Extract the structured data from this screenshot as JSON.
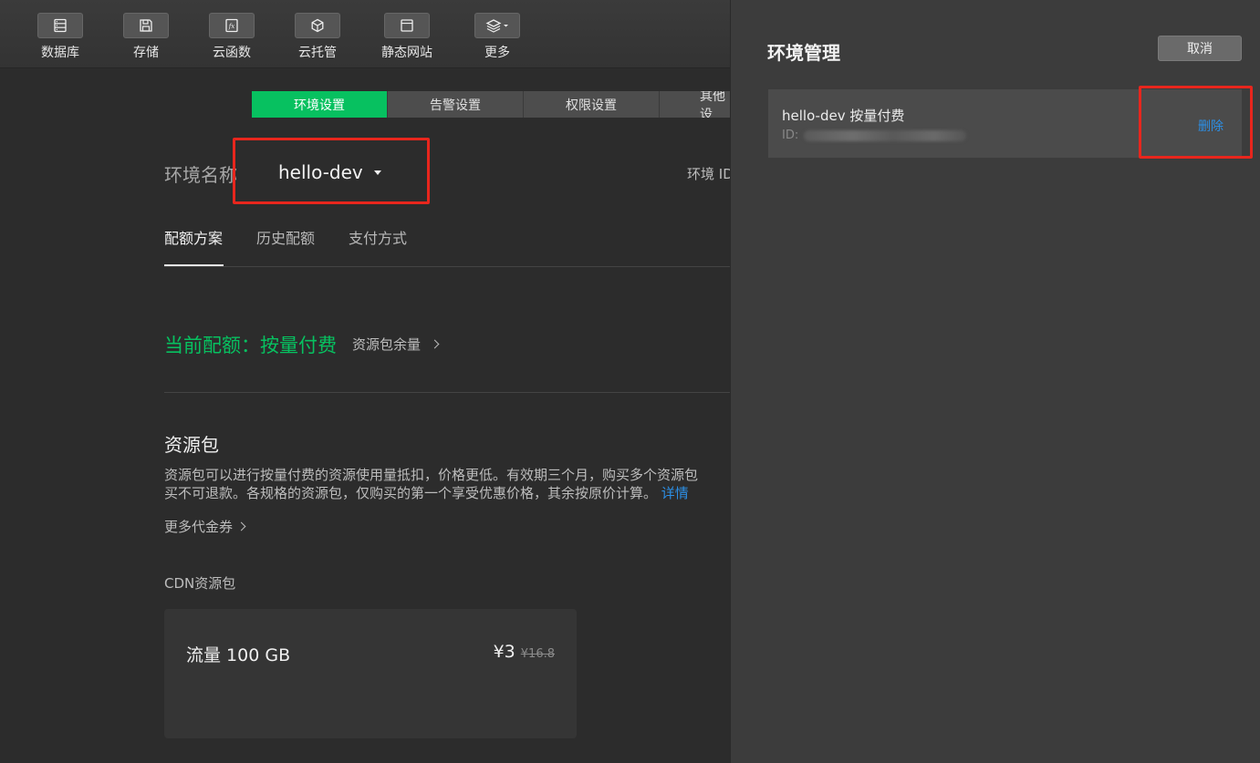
{
  "toolbar": {
    "items": [
      {
        "label": "数据库",
        "icon": "database-icon"
      },
      {
        "label": "存储",
        "icon": "storage-icon"
      },
      {
        "label": "云函数",
        "icon": "function-icon"
      },
      {
        "label": "云托管",
        "icon": "cloud-hosting-icon"
      },
      {
        "label": "静态网站",
        "icon": "static-website-icon"
      },
      {
        "label": "更多",
        "icon": "layers-icon"
      }
    ]
  },
  "tabs": [
    "环境设置",
    "告警设置",
    "权限设置",
    "其他设"
  ],
  "env": {
    "label": "环境名称",
    "value": "hello-dev",
    "id_label": "环境 ID"
  },
  "subtabs": [
    "配额方案",
    "历史配额",
    "支付方式"
  ],
  "quota": {
    "current": "当前配额：按量付费",
    "link": "资源包余量"
  },
  "resource": {
    "title": "资源包",
    "desc_line1": "资源包可以进行按量付费的资源使用量抵扣，价格更低。有效期三个月，购买多个资源包",
    "desc_line2": "买不可退款。各规格的资源包，仅购买的第一个享受优惠价格，其余按原价计算。",
    "detail_link": "详情",
    "more_coupons": "更多代金券",
    "cdn_label": "CDN资源包",
    "card": {
      "name": "流量 100 GB",
      "price": "¥3",
      "old_price": "¥16.8"
    }
  },
  "panel": {
    "title": "环境管理",
    "cancel": "取消",
    "env_row": {
      "name": "hello-dev 按量付费",
      "id_prefix": "ID:",
      "delete": "删除"
    }
  },
  "colors": {
    "accent": "#07c160",
    "link": "#2c8fe5",
    "highlight": "#e8261d"
  }
}
